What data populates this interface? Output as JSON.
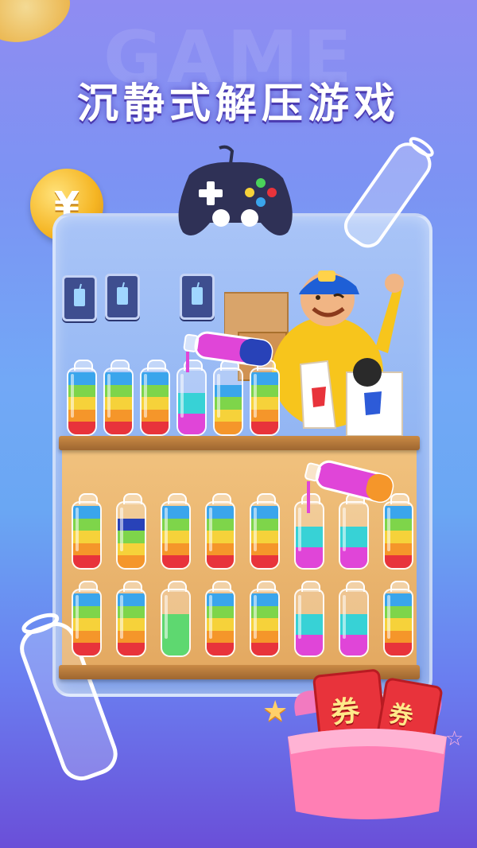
{
  "headline": "沉静式解压游戏",
  "background_word": "GAME",
  "coin_symbol": "¥",
  "coupon_labels": [
    "券",
    "券"
  ],
  "colors": {
    "red": "#e8333b",
    "orange": "#f5962a",
    "yellow": "#f6d23a",
    "green": "#7ed54a",
    "cyan": "#37d2d6",
    "blue": "#3aa5ec",
    "navy": "#2842b8",
    "magenta": "#e045d8",
    "lightgreen": "#5ed870"
  },
  "top_shelf_bottles": [
    [
      "blue",
      "green",
      "yellow",
      "orange",
      "red"
    ],
    [
      "blue",
      "green",
      "yellow",
      "orange",
      "red"
    ],
    [
      "blue",
      "green",
      "yellow",
      "orange",
      "red"
    ],
    [
      "cyan",
      "magenta"
    ],
    [
      "blue",
      "green",
      "yellow",
      "orange"
    ],
    [
      "blue",
      "green",
      "yellow",
      "orange",
      "red"
    ]
  ],
  "middle_shelf_bottles": [
    [
      "blue",
      "green",
      "yellow",
      "orange",
      "red"
    ],
    [
      "navy",
      "green",
      "yellow",
      "orange"
    ],
    [
      "blue",
      "green",
      "yellow",
      "orange",
      "red"
    ],
    [
      "blue",
      "green",
      "yellow",
      "orange",
      "red"
    ],
    [
      "blue",
      "green",
      "yellow",
      "orange",
      "red"
    ],
    [
      "cyan",
      "magenta"
    ],
    [
      "cyan",
      "magenta"
    ],
    [
      "blue",
      "green",
      "yellow",
      "orange",
      "red"
    ]
  ],
  "bottom_shelf_bottles": [
    [
      "blue",
      "green",
      "yellow",
      "orange",
      "red"
    ],
    [
      "blue",
      "green",
      "yellow",
      "orange",
      "red"
    ],
    [
      "lightgreen"
    ],
    [
      "blue",
      "green",
      "yellow",
      "orange",
      "red"
    ],
    [
      "blue",
      "green",
      "yellow",
      "orange",
      "red"
    ],
    [
      "cyan",
      "magenta"
    ],
    [
      "cyan",
      "magenta"
    ],
    [
      "blue",
      "green",
      "yellow",
      "orange",
      "red"
    ]
  ],
  "icons": [
    "gamepad-icon",
    "coin-icon",
    "drink-card-icon",
    "star-icon",
    "coupon-icon"
  ]
}
